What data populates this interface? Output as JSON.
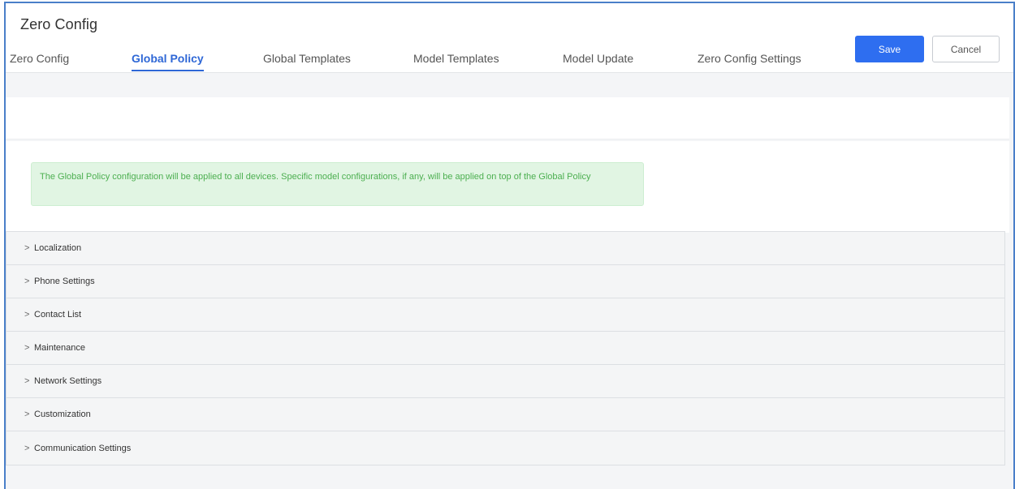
{
  "app": {
    "title": "Zero Config"
  },
  "tabs": [
    {
      "label": "Zero Config",
      "active": false
    },
    {
      "label": "Global Policy",
      "active": true
    },
    {
      "label": "Global Templates",
      "active": false
    },
    {
      "label": "Model Templates",
      "active": false
    },
    {
      "label": "Model Update",
      "active": false
    },
    {
      "label": "Zero Config Settings",
      "active": false
    }
  ],
  "toolbar": {
    "save_label": "Save",
    "cancel_label": "Cancel"
  },
  "notice": {
    "text": "The Global Policy configuration will be applied to all devices. Specific model configurations, if any, will be applied on top of the Global Policy"
  },
  "sections": [
    {
      "label": "Localization"
    },
    {
      "label": "Phone Settings"
    },
    {
      "label": "Contact List"
    },
    {
      "label": "Maintenance"
    },
    {
      "label": "Network Settings"
    },
    {
      "label": "Customization"
    },
    {
      "label": "Communication Settings"
    }
  ],
  "icons": {
    "expand": "chevron-right-icon"
  },
  "colors": {
    "accent": "#2e67d6",
    "save_button": "#2e6ef0",
    "notice_bg": "#e1f5e3",
    "notice_text": "#4caf50"
  }
}
